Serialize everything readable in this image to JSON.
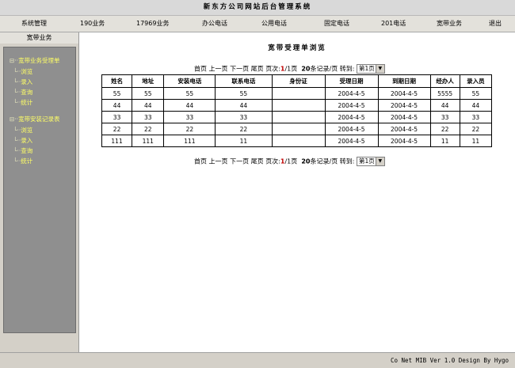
{
  "app": {
    "title": "新东方公司网站后台管理系统"
  },
  "nav": [
    "系统管理",
    "190业务",
    "17969业务",
    "办公电话",
    "公用电话",
    "固定电话",
    "201电话",
    "宽带业务",
    "退出"
  ],
  "sidebar": {
    "header": "宽带业务",
    "groups": [
      {
        "label": "宽带业务受理单",
        "items": [
          "浏览",
          "录入",
          "查询",
          "统计"
        ]
      },
      {
        "label": "宽带安装记录表",
        "items": [
          "浏览",
          "录入",
          "查询",
          "统计"
        ]
      }
    ]
  },
  "main": {
    "title": "宽带受理单浏览",
    "pager": {
      "first": "首页",
      "prev": "上一页",
      "next": "下一页",
      "last": "尾页",
      "page_prefix": "页次:",
      "current": "1",
      "sep": "/",
      "total": "1",
      "page_suffix": "页",
      "per_page": "20",
      "per_page_suffix": "条记录/页",
      "goto": "转到:",
      "select_value": "第1页"
    },
    "table": {
      "headers": [
        "姓名",
        "地址",
        "安装电话",
        "联系电话",
        "身份证",
        "受理日期",
        "到期日期",
        "经办人",
        "录入员"
      ],
      "rows": [
        [
          "55",
          "55",
          "55",
          "55",
          "",
          "2004-4-5",
          "2004-4-5",
          "5555",
          "55"
        ],
        [
          "44",
          "44",
          "44",
          "44",
          "",
          "2004-4-5",
          "2004-4-5",
          "44",
          "44"
        ],
        [
          "33",
          "33",
          "33",
          "33",
          "",
          "2004-4-5",
          "2004-4-5",
          "33",
          "33"
        ],
        [
          "22",
          "22",
          "22",
          "22",
          "",
          "2004-4-5",
          "2004-4-5",
          "22",
          "22"
        ],
        [
          "111",
          "111",
          "111",
          "11",
          "",
          "2004-4-5",
          "2004-4-5",
          "11",
          "11"
        ]
      ]
    }
  },
  "footer": {
    "text": "Co Net MIB Ver 1.0  Design By Hygo"
  }
}
